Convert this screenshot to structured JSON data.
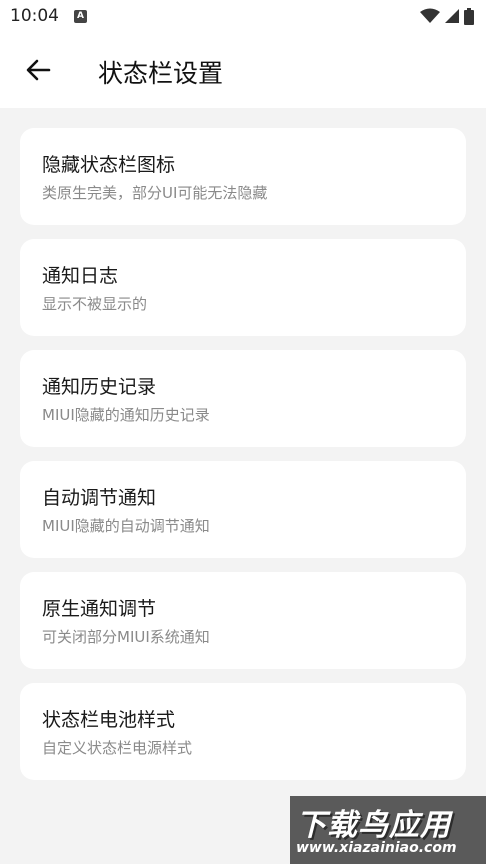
{
  "status_bar": {
    "time": "10:04",
    "notification_icon": "A"
  },
  "app_bar": {
    "title": "状态栏设置"
  },
  "items": [
    {
      "title": "隐藏状态栏图标",
      "subtitle": "类原生完美，部分UI可能无法隐藏"
    },
    {
      "title": "通知日志",
      "subtitle": "显示不被显示的"
    },
    {
      "title": "通知历史记录",
      "subtitle": "MIUI隐藏的通知历史记录"
    },
    {
      "title": "自动调节通知",
      "subtitle": "MIUI隐藏的自动调节通知"
    },
    {
      "title": "原生通知调节",
      "subtitle": "可关闭部分MIUI系统通知"
    },
    {
      "title": "状态栏电池样式",
      "subtitle": "自定义状态栏电源样式"
    }
  ],
  "watermark": {
    "main": "下载鸟应用",
    "url": "www.xiazainiao.com"
  },
  "icons": {
    "back": "arrow-left-icon",
    "wifi": "wifi-icon",
    "signal": "cellular-signal-icon",
    "battery": "battery-icon"
  }
}
